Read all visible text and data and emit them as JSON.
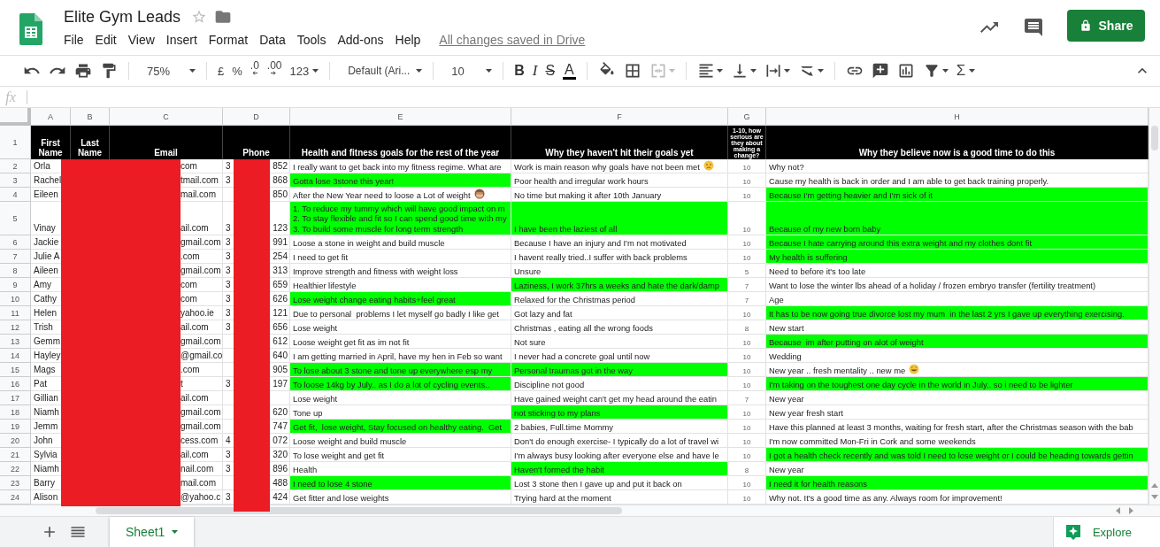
{
  "app": {
    "title": "Elite Gym Leads",
    "menus": [
      "File",
      "Edit",
      "View",
      "Insert",
      "Format",
      "Data",
      "Tools",
      "Add-ons",
      "Help"
    ],
    "save_status": "All changes saved in Drive",
    "share_label": "Share"
  },
  "toolbar": {
    "zoom": "75%",
    "currency": "£",
    "percent": "%",
    "decrease_decimals": ".0",
    "increase_decimals": ".00",
    "number_format": "123",
    "font": "Default (Ari...",
    "font_size": "10",
    "bold": "B",
    "italic": "I",
    "strikethrough": "S",
    "text_color": "A",
    "functions": "Σ"
  },
  "formula_bar": {
    "label": "fx"
  },
  "columns": [
    "A",
    "B",
    "C",
    "D",
    "E",
    "F",
    "G",
    "H"
  ],
  "header_row": {
    "number": "1",
    "cells": [
      "First Name",
      "Last Name",
      "Email",
      "Phone",
      "Health and fitness goals for the rest of the year",
      "Why they haven't hit their goals yet",
      "1-10, how serious are they about making a change?",
      "Why they believe now is a good time to do this"
    ]
  },
  "rows": [
    {
      "number": "2",
      "first_name": "Orla",
      "email": "com",
      "phone_start": "3",
      "phone_end": "852",
      "goal": {
        "text": "I really want to get back into my fitness regime. What are",
        "highlighted": false
      },
      "obstacle": {
        "text": "Work is main reason why goals have not been met",
        "highlighted": false,
        "kind": "sad-emoji"
      },
      "seriousness": "10",
      "reason": {
        "text": "Why not?",
        "highlighted": false
      }
    },
    {
      "number": "3",
      "first_name": "Rachel",
      "email": "tmail.com",
      "phone_start": "3",
      "phone_end": "868",
      "goal": {
        "text": "Gotta lose 3stone this year!",
        "highlighted": true
      },
      "obstacle": {
        "text": "Poor health and irregular work hours",
        "highlighted": false
      },
      "seriousness": "10",
      "reason": {
        "text": "Cause my health is back in order and I am able to get back training properly.",
        "highlighted": false
      }
    },
    {
      "number": "4",
      "first_name": "Eileen",
      "email": "mail.com",
      "phone_end": "850",
      "goal": {
        "text": "After the New Year need to loose a Lot of weight",
        "highlighted": false,
        "kind": "monkey-emoji"
      },
      "obstacle": {
        "text": "No time but making it after 10th January",
        "highlighted": false
      },
      "seriousness": "10",
      "reason": {
        "text": "Because I'm getting heavier and I'm sick of it",
        "highlighted": true
      }
    },
    {
      "number": "5",
      "tall": true,
      "first_name": "Vinay",
      "email": "ail.com",
      "phone_start": "3",
      "phone_end": "123",
      "goal": {
        "text": "1. To reduce my tummy which will have good impact on m\n2. To stay flexible and fit so I can spend good time with my\n3. To build some muscle for long term strength",
        "highlighted": true
      },
      "obstacle": {
        "text": "I have been the laziest of all",
        "highlighted": true
      },
      "seriousness": "10",
      "reason": {
        "text": "Because of my new born baby",
        "highlighted": true
      }
    },
    {
      "number": "6",
      "first_name": "Jackie",
      "email": "gmail.com",
      "phone_start": "3",
      "phone_end": "991",
      "goal": {
        "text": "Loose a stone in weight and build muscle",
        "highlighted": false
      },
      "obstacle": {
        "text": "Because I have an injury and I'm not motivated",
        "highlighted": false
      },
      "seriousness": "10",
      "reason": {
        "text": "Because I hate carrying around this extra weight and my clothes dont fit",
        "highlighted": true
      }
    },
    {
      "number": "7",
      "first_name": "Julie A",
      "email": ".com",
      "phone_start": "3",
      "phone_end": "254",
      "goal": {
        "text": "I need to get fit",
        "highlighted": false
      },
      "obstacle": {
        "text": "I havent really tried..I suffer with back problems",
        "highlighted": false
      },
      "seriousness": "10",
      "reason": {
        "text": "My health is suffering",
        "highlighted": true
      }
    },
    {
      "number": "8",
      "first_name": "Aileen",
      "email": "gmail.com",
      "phone_start": "3",
      "phone_end": "313",
      "goal": {
        "text": "Improve strength and fitness with weight loss",
        "highlighted": false
      },
      "obstacle": {
        "text": "Unsure",
        "highlighted": false
      },
      "seriousness": "5",
      "reason": {
        "text": "Need to before it's too late",
        "highlighted": false
      }
    },
    {
      "number": "9",
      "first_name": "Amy",
      "email": "com",
      "phone_start": "3",
      "phone_end": "659",
      "goal": {
        "text": "Healthier lifestyle",
        "highlighted": false
      },
      "obstacle": {
        "text": "Laziness, I work 37hrs a weeks and hate the dark/damp",
        "highlighted": true
      },
      "seriousness": "7",
      "reason": {
        "text": "Want to lose the winter lbs ahead of a holiday / frozen embryo transfer (fertility treatment)",
        "highlighted": false
      }
    },
    {
      "number": "10",
      "first_name": "Cathy",
      "email": "com",
      "phone_start": "3",
      "phone_end": "626",
      "goal": {
        "text": "Lose weight change eating habits+feel great",
        "highlighted": true
      },
      "obstacle": {
        "text": "Relaxed for the Christmas period",
        "highlighted": false
      },
      "seriousness": "7",
      "reason": {
        "text": "Age",
        "highlighted": false
      }
    },
    {
      "number": "11",
      "first_name": "Helen",
      "email": "yahoo.ie",
      "phone_start": "3",
      "phone_end": "121",
      "goal": {
        "text": "Due to personal  problems I let myself go badly I like get",
        "highlighted": false
      },
      "obstacle": {
        "text": "Got lazy and fat",
        "highlighted": false
      },
      "seriousness": "10",
      "reason": {
        "text": "It has to be now going true divorce lost my mum  in the last 2 yrs I gave up everything exercising.",
        "highlighted": true
      }
    },
    {
      "number": "12",
      "first_name": "Trish",
      "email": "ail.com",
      "phone_start": "3",
      "phone_end": "656",
      "goal": {
        "text": "Lose weight",
        "highlighted": false
      },
      "obstacle": {
        "text": "Christmas , eating all the wrong foods",
        "highlighted": false
      },
      "seriousness": "8",
      "reason": {
        "text": "New start",
        "highlighted": false
      }
    },
    {
      "number": "13",
      "first_name": "Gemm",
      "email": "gmail.com",
      "phone_end": "612",
      "goal": {
        "text": "Loose weight get fit as im not fit",
        "highlighted": false
      },
      "obstacle": {
        "text": "Not sure",
        "highlighted": false
      },
      "seriousness": "10",
      "reason": {
        "text": "Because  im after putting on alot of weight",
        "highlighted": true
      }
    },
    {
      "number": "14",
      "first_name": "Hayley",
      "email": "@gmail.co",
      "phone_end": "640",
      "goal": {
        "text": "I am getting married in April, have my hen in Feb so want",
        "highlighted": false
      },
      "obstacle": {
        "text": "I never had a concrete goal until now",
        "highlighted": false
      },
      "seriousness": "10",
      "reason": {
        "text": "Wedding",
        "highlighted": false
      }
    },
    {
      "number": "15",
      "first_name": "Mags",
      "email": ".com",
      "phone_end": "905",
      "goal": {
        "text": "To lose about 3 stone and tone up everywhere esp my",
        "highlighted": true
      },
      "obstacle": {
        "text": "Personal traumas got in the way",
        "highlighted": true
      },
      "seriousness": "10",
      "reason": {
        "text": "New year .. fresh mentality .. new me",
        "highlighted": false,
        "kind": "laugh-emoji"
      }
    },
    {
      "number": "16",
      "first_name": "Pat",
      "email": "t",
      "phone_start": "3",
      "phone_end": "197",
      "goal": {
        "text": "To loose 14kg by July.. as I do a lot of cycling events..",
        "highlighted": true
      },
      "obstacle": {
        "text": "Discipline not good",
        "highlighted": false
      },
      "seriousness": "10",
      "reason": {
        "text": "I'm taking on the toughest one day cycle in the world in July.. so i need to be lighter",
        "highlighted": true
      }
    },
    {
      "number": "17",
      "first_name": "Gillian",
      "email": "ail.com",
      "goal": {
        "text": "Lose weight",
        "highlighted": false
      },
      "obstacle": {
        "text": "Have gained weight can't get my head around the eatin",
        "highlighted": false
      },
      "seriousness": "7",
      "reason": {
        "text": "New year",
        "highlighted": false
      }
    },
    {
      "number": "18",
      "first_name": "Niamh",
      "email": "gmail.com",
      "phone_end": "620",
      "goal": {
        "text": "Tone up",
        "highlighted": false
      },
      "obstacle": {
        "text": "not sticking to my plans",
        "highlighted": true
      },
      "seriousness": "10",
      "reason": {
        "text": "New year fresh start",
        "highlighted": false
      }
    },
    {
      "number": "19",
      "first_name": "Jemm",
      "email": "gmail.com",
      "phone_end": "747",
      "goal": {
        "text": "Get fit,  lose weight, Stay focused on healthy eating.  Get",
        "highlighted": true
      },
      "obstacle": {
        "text": "2 babies, Full.time Mommy",
        "highlighted": false
      },
      "seriousness": "10",
      "reason": {
        "text": "Have this planned at least 3 months, waiting for fresh start, after the Christmas season with the bab",
        "highlighted": false
      }
    },
    {
      "number": "20",
      "first_name": "John",
      "email": "cess.com",
      "phone_start": "4",
      "phone_end": "072",
      "goal": {
        "text": "Loose weight and build muscle",
        "highlighted": false
      },
      "obstacle": {
        "text": "Don't do enough exercise- I typically do a lot of travel wi",
        "highlighted": false
      },
      "seriousness": "10",
      "reason": {
        "text": "I'm now committed Mon-Fri in Cork and some weekends",
        "highlighted": false
      }
    },
    {
      "number": "21",
      "first_name": "Sylvia",
      "email": "ail.com",
      "phone_start": "3",
      "phone_end": "320",
      "goal": {
        "text": "To lose weight and get fit",
        "highlighted": false
      },
      "obstacle": {
        "text": "I'm always busy looking after everyone else and have le",
        "highlighted": false
      },
      "seriousness": "10",
      "reason": {
        "text": "I got a health check recently and was told I need to lose weight or I could be heading towards gettin",
        "highlighted": true
      }
    },
    {
      "number": "22",
      "first_name": "Niamh",
      "email": "nail.com",
      "phone_start": "3",
      "phone_end": "896",
      "goal": {
        "text": "Health",
        "highlighted": false
      },
      "obstacle": {
        "text": "Haven't formed the habit",
        "highlighted": true
      },
      "seriousness": "8",
      "reason": {
        "text": "New year",
        "highlighted": false
      }
    },
    {
      "number": "23",
      "first_name": "Barry",
      "email": "mail.com",
      "phone_end": "488",
      "goal": {
        "text": "I need to lose 4 stone",
        "highlighted": true
      },
      "obstacle": {
        "text": "Lost 3 stone then I gave up and put it back on",
        "highlighted": false
      },
      "seriousness": "10",
      "reason": {
        "text": "I need it for health reasons",
        "highlighted": true
      }
    },
    {
      "number": "24",
      "first_name": "Alison",
      "email": "@yahoo.c",
      "phone_start": "3",
      "phone_end": "424",
      "goal": {
        "text": "Get fitter and lose weights",
        "highlighted": false
      },
      "obstacle": {
        "text": "Trying hard at the moment",
        "highlighted": false
      },
      "seriousness": "10",
      "reason": {
        "text": "Why not. It's a good time as any. Always room for improvement!",
        "highlighted": false
      }
    }
  ],
  "sheets": [
    {
      "label": "Sheet1",
      "selected": true
    }
  ],
  "explore_label": "Explore"
}
